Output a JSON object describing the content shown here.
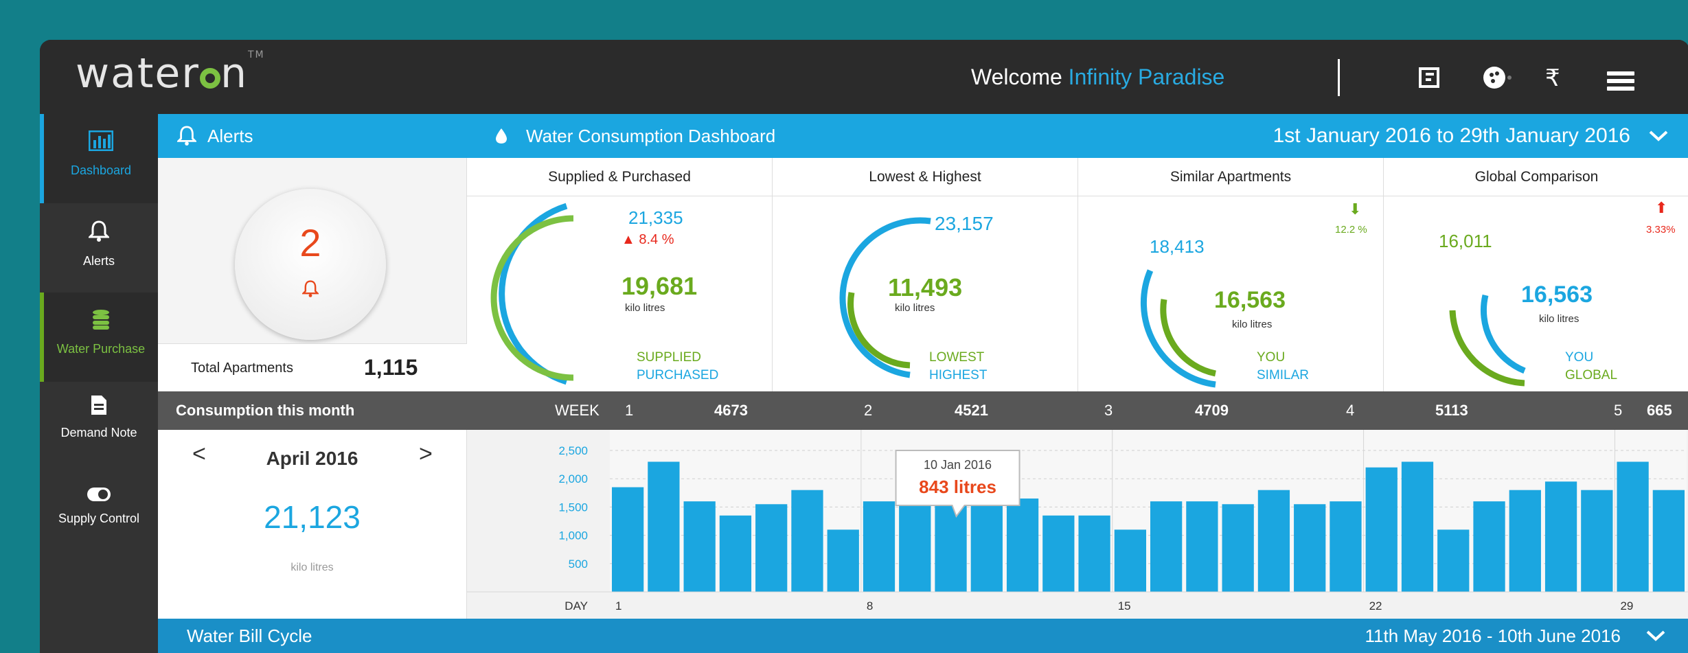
{
  "header": {
    "logo": "wateron",
    "logo_tm": "TM",
    "welcome": "Welcome",
    "user": "Infinity Paradise",
    "icons": [
      "bill-icon",
      "globe-icon",
      "rupee-icon",
      "menu-icon"
    ],
    "rupee": "₹"
  },
  "sidebar": {
    "items": [
      {
        "label": "Dashboard",
        "icon": "bar-chart-icon"
      },
      {
        "label": "Alerts",
        "icon": "bell-icon"
      },
      {
        "label": "Water Purchase",
        "icon": "database-icon"
      },
      {
        "label": "Demand Note",
        "icon": "document-icon"
      },
      {
        "label": "Supply Control",
        "icon": "toggle-icon"
      }
    ]
  },
  "alerts": {
    "title": "Alerts",
    "count": "2",
    "total_label": "Total Apartments",
    "total_value": "1,115"
  },
  "dashboard": {
    "title": "Water Consumption Dashboard",
    "range": "1st January 2016 to 29th January 2016",
    "panels": [
      {
        "title": "Supplied & Purchased",
        "top_value": "21,335",
        "change": "8.4 %",
        "center_value": "19,681",
        "unit": "kilo litres",
        "label1": "SUPPLIED",
        "label2": "PURCHASED"
      },
      {
        "title": "Lowest & Highest",
        "top_value": "23,157",
        "center_value": "11,493",
        "unit": "kilo litres",
        "label1": "LOWEST",
        "label2": "HIGHEST"
      },
      {
        "title": "Similar Apartments",
        "top_value": "18,413",
        "change": "12.2 %",
        "center_value": "16,563",
        "unit": "kilo litres",
        "label1": "YOU",
        "label2": "SIMILAR"
      },
      {
        "title": "Global Comparison",
        "top_value": "16,011",
        "change": "3.33%",
        "center_value": "16,563",
        "unit": "kilo litres",
        "label1": "YOU",
        "label2": "GLOBAL"
      }
    ]
  },
  "consumption": {
    "title": "Consumption this month",
    "week_label": "WEEK",
    "weeks": [
      {
        "n": "1",
        "v": "4673"
      },
      {
        "n": "2",
        "v": "4521"
      },
      {
        "n": "3",
        "v": "4709"
      },
      {
        "n": "4",
        "v": "5113"
      },
      {
        "n": "5",
        "v": "665"
      }
    ],
    "month": "April 2016",
    "month_value": "21,123",
    "month_unit": "kilo litres",
    "prev": "<",
    "next": ">"
  },
  "chart_data": {
    "type": "bar",
    "xlabel": "DAY",
    "ylim": [
      0,
      2500
    ],
    "y_ticks": [
      "2,500",
      "2,000",
      "1,500",
      "1,000",
      "500"
    ],
    "x_tick_labels": [
      "1",
      "8",
      "15",
      "22",
      "29"
    ],
    "days": [
      1,
      2,
      3,
      4,
      5,
      6,
      7,
      8,
      9,
      10,
      11,
      12,
      13,
      14,
      15,
      16,
      17,
      18,
      19,
      20,
      21,
      22,
      23,
      24,
      25,
      26,
      27,
      28,
      29
    ],
    "values": [
      1850,
      2300,
      1600,
      1350,
      1550,
      1800,
      1100,
      1600,
      1800,
      1850,
      1950,
      1650,
      1350,
      1350,
      1100,
      1600,
      1600,
      1550,
      1800,
      1550,
      1600,
      2200,
      2300,
      1100,
      1600,
      1800,
      1950,
      1800,
      2300,
      1800
    ],
    "tooltip": {
      "date": "10 Jan 2016",
      "value": "843 litres",
      "day_index": 9
    },
    "colors": {
      "bar": "#1ba6e0",
      "tooltip_value": "#e8481c"
    }
  },
  "bill": {
    "title": "Water Bill Cycle",
    "range": "11th May 2016 - 10th June 2016"
  },
  "colors": {
    "accent": "#1ba6e0",
    "green": "#6aaa1e",
    "alert": "#e8281c",
    "background": "#127f89"
  }
}
